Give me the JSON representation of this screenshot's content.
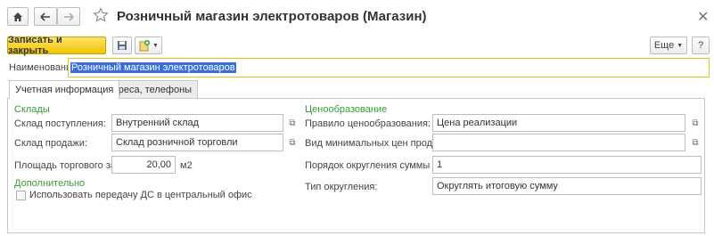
{
  "header": {
    "title": "Розничный магазин электротоваров (Магазин)",
    "home_icon": "home-icon",
    "back_icon": "arrow-left-icon",
    "forward_icon": "arrow-right-icon",
    "favorite_icon": "star-icon",
    "close_icon": "close-icon"
  },
  "toolbar": {
    "save_close_label": "Записать и закрыть",
    "more_label": "Еще",
    "help_label": "?",
    "accent": "#f1c400"
  },
  "form": {
    "name_label": "Наименование:",
    "name_value": "Розничный магазин электротоваров"
  },
  "tabs": [
    {
      "label": "Учетная информация",
      "active": true
    },
    {
      "label": "Адреса, телефоны",
      "active": false
    }
  ],
  "left": {
    "section_title": "Склады",
    "receipt_warehouse_label": "Склад поступления:",
    "receipt_warehouse_value": "Внутренний склад",
    "sale_warehouse_label": "Склад продажи:",
    "sale_warehouse_value": "Склад розничной торговли",
    "area_label": "Площадь торгового зала:",
    "area_value": "20,00",
    "area_unit": "м2",
    "extra_title": "Дополнительно",
    "transfer_label": "Использовать передачу ДС в центральный офис",
    "transfer_checked": false
  },
  "right": {
    "section_title": "Ценообразование",
    "pricing_rule_label": "Правило ценообразования:",
    "pricing_rule_value": "Цена реализации",
    "min_price_label": "Вид минимальных цен продажи:",
    "min_price_value": "",
    "rounding_order_label": "Порядок округления суммы чека:",
    "rounding_order_value": "1",
    "rounding_type_label": "Тип округления:",
    "rounding_type_value": "Округлять итоговую сумму"
  }
}
